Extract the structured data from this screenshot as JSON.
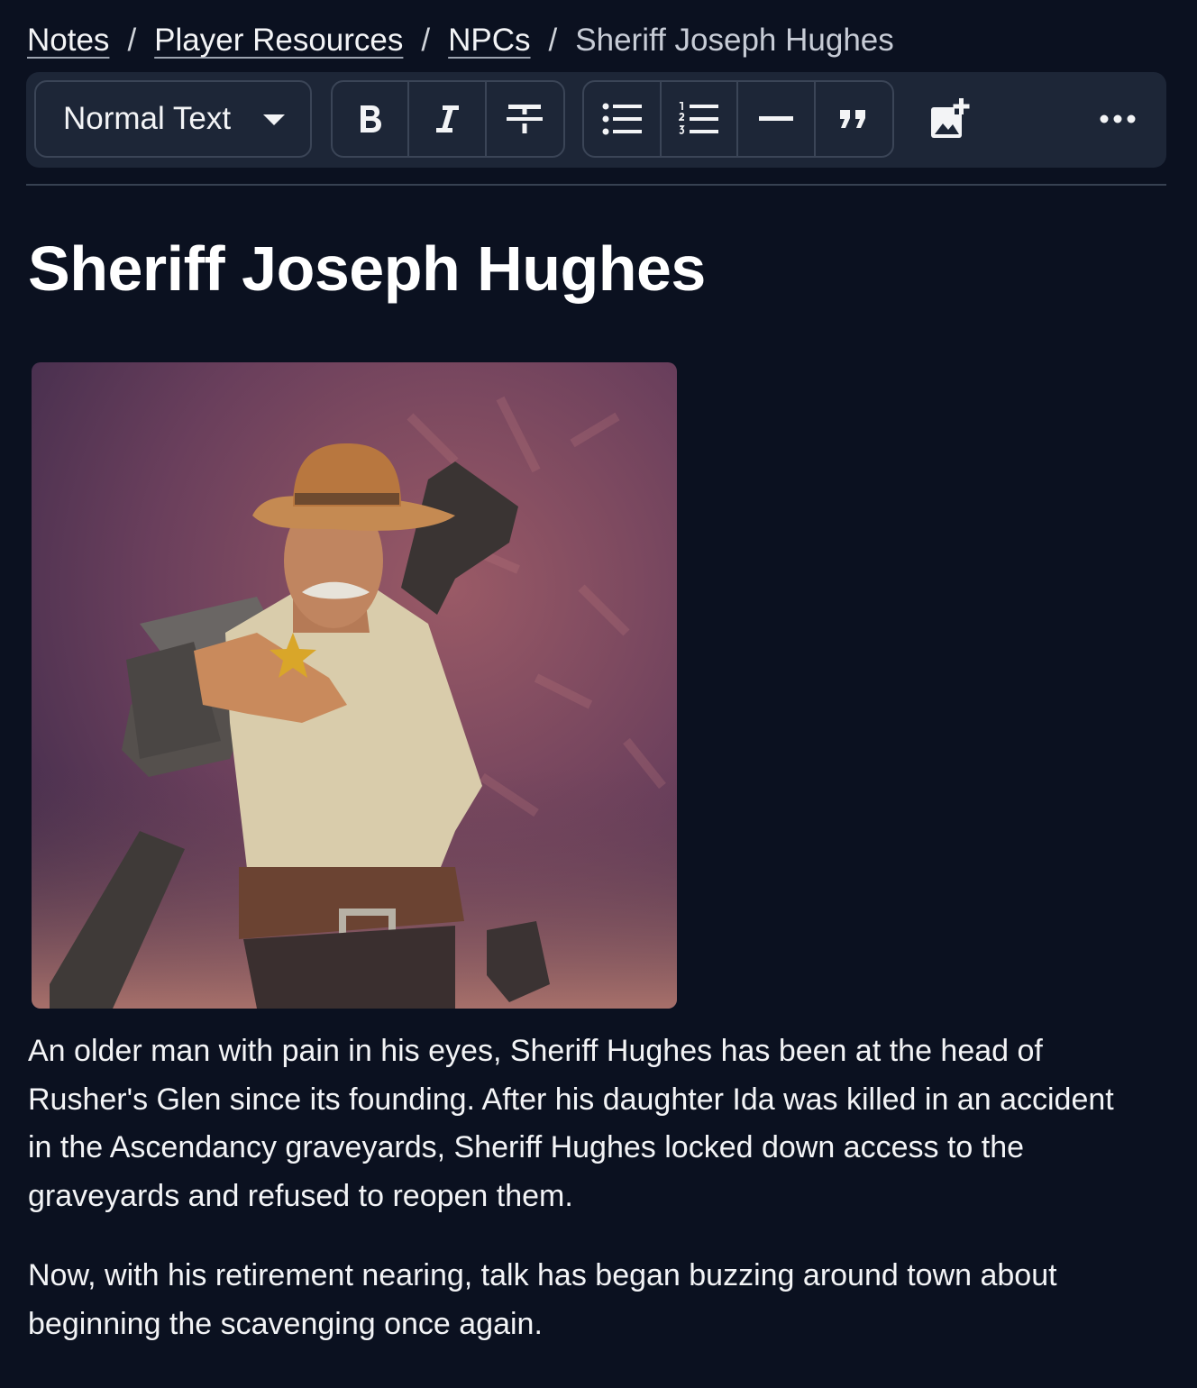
{
  "breadcrumb": {
    "items": [
      {
        "label": "Notes"
      },
      {
        "label": "Player Resources"
      },
      {
        "label": "NPCs"
      }
    ],
    "separator": "/",
    "current": "Sheriff Joseph Hughes"
  },
  "toolbar": {
    "text_style": "Normal Text",
    "buttons": {
      "bold": "bold-icon",
      "italic": "italic-icon",
      "strikethrough": "strikethrough-icon",
      "bullet_list": "bullet-list-icon",
      "numbered_list": "numbered-list-icon",
      "horizontal_rule": "horizontal-rule-icon",
      "quote": "quote-icon",
      "insert_image": "add-image-icon",
      "more": "more-icon"
    }
  },
  "document": {
    "title": "Sheriff Joseph Hughes",
    "image": {
      "subject": "NPC portrait"
    },
    "paragraphs": [
      "An older man with pain in his eyes, Sheriff Hughes has been at the head of Rusher's Glen since its founding. After his daughter Ida was killed in an accident in the Ascendancy graveyards, Sheriff Hughes locked down access to the graveyards and refused to reopen them.",
      "Now, with his retirement nearing, talk has began buzzing around town about beginning the scavenging once again."
    ]
  },
  "colors": {
    "background": "#0b1120",
    "toolbar": "#1d2637",
    "border": "#3b4557",
    "text": "#f3f4f6"
  }
}
